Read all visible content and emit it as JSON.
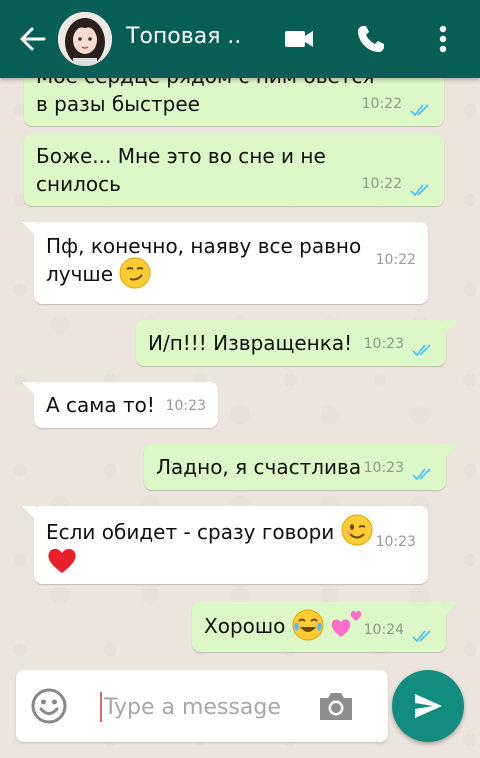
{
  "header": {
    "contact_name": "Топовая ..",
    "bg_color": "#075e54"
  },
  "messages": [
    {
      "direction": "out",
      "text_line1": "Моё сердце рядом с ним бьется",
      "text_line2": "в разы быстрее",
      "time": "10:22",
      "status": "read"
    },
    {
      "direction": "out",
      "text_line1": "Боже... Мне это во сне и не",
      "text_line2": "снилось",
      "time": "10:22",
      "status": "read"
    },
    {
      "direction": "in",
      "text_line1": "Пф, конечно, наяву все равно",
      "text_line2": "лучше",
      "time": "10:22",
      "emoji": "smirk-face-emoji"
    },
    {
      "direction": "out",
      "text": "И/п!!! Извращенка!",
      "time": "10:23",
      "status": "read"
    },
    {
      "direction": "in",
      "text": "А сама то!",
      "time": "10:23"
    },
    {
      "direction": "out",
      "text": "Ладно, я счастлива",
      "time": "10:23",
      "status": "read"
    },
    {
      "direction": "in",
      "text": "Если обидет - сразу говори",
      "time": "10:23",
      "emoji": [
        "wink-face-emoji",
        "red-heart-emoji"
      ]
    },
    {
      "direction": "out",
      "text": "Хорошо",
      "time": "10:24",
      "status": "read",
      "emoji": [
        "tears-of-joy-emoji",
        "two-hearts-emoji"
      ]
    }
  ],
  "composer": {
    "placeholder": "Type a message"
  },
  "colors": {
    "outgoing_bubble": "#dcf8c6",
    "incoming_bubble": "#ffffff",
    "read_tick": "#4fc3f7",
    "send_button": "#128c7e"
  }
}
